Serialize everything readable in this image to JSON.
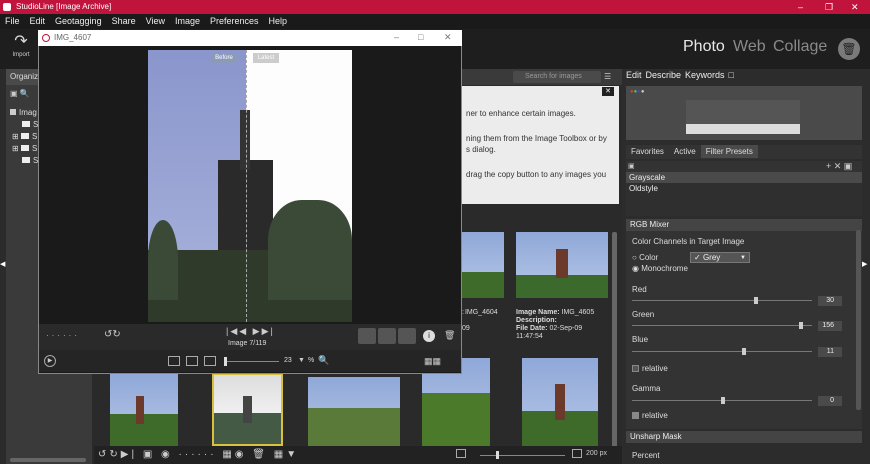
{
  "app": {
    "title": "StudioLine [Image Archive]"
  },
  "menu": [
    "File",
    "Edit",
    "Geotagging",
    "Share",
    "View",
    "Image",
    "Preferences",
    "Help"
  ],
  "toolbar": {
    "import_label": "Import",
    "modes": [
      "Photo",
      "Web",
      "Collage"
    ]
  },
  "left": {
    "tab": "Organiz",
    "tree_root": "Imag",
    "items": [
      "S",
      "S",
      "S",
      "S"
    ]
  },
  "search": {
    "placeholder": "Search for images"
  },
  "tip": {
    "line1": "ner to enhance certain images.",
    "line2": "ning them from the Image Toolbox or by",
    "line3": "s dialog.",
    "line4": "drag the copy button to any images you"
  },
  "grid": {
    "items": [
      {
        "name_label": "Image Name:",
        "name": "IMG_4604",
        "date": "09",
        "extra": ""
      },
      {
        "name_label": "Image Name:",
        "name": "IMG_4605",
        "desc_label": "Description:",
        "date_label": "File Date:",
        "date": "02-Sep-09",
        "time": "11:47:54"
      }
    ],
    "left_labels": [
      ":",
      "09"
    ]
  },
  "preview": {
    "title": "IMG_4607",
    "before_label": "Before",
    "latest_label": "Latest",
    "counter": "Image 7/119",
    "zoom": "23",
    "zoom_unit": "%"
  },
  "bottombar": {
    "size": "200 px"
  },
  "right": {
    "tabs": [
      "Edit",
      "Describe",
      "Keywords"
    ],
    "sub_tabs": [
      "Favorites",
      "Active",
      "Filter Presets"
    ],
    "presets": [
      "Grayscale",
      "Oldstyle"
    ],
    "rgb": {
      "title": "RGB Mixer",
      "target_label": "Color Channels in Target Image",
      "opt_color": "Color",
      "opt_mono": "Monochrome",
      "grey_select": "Grey",
      "red_label": "Red",
      "red_value": "30",
      "green_label": "Green",
      "green_value": "156",
      "blue_label": "Blue",
      "blue_value": "11",
      "relative1": "relative",
      "gamma_label": "Gamma",
      "gamma_value": "0",
      "relative2": "relative"
    },
    "unsharp": {
      "title": "Unsharp Mask",
      "percent_label": "Percent"
    }
  }
}
